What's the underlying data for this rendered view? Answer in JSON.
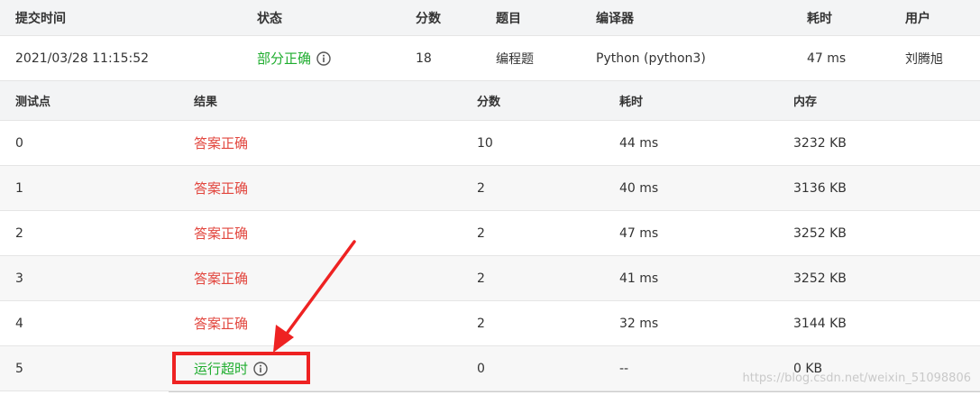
{
  "summary": {
    "headers": {
      "submit_time": "提交时间",
      "status": "状态",
      "score": "分数",
      "problem": "题目",
      "compiler": "编译器",
      "time_cost": "耗时",
      "user": "用户"
    },
    "row": {
      "submit_time": "2021/03/28 11:15:52",
      "status": "部分正确",
      "score": "18",
      "problem": "编程题",
      "compiler": "Python (python3)",
      "time_cost": "47 ms",
      "user": "刘腾旭"
    }
  },
  "details": {
    "headers": {
      "case": "测试点",
      "result": "结果",
      "score": "分数",
      "time_cost": "耗时",
      "memory": "内存"
    },
    "rows": [
      {
        "case": "0",
        "result": "答案正确",
        "score": "10",
        "time_cost": "44 ms",
        "memory": "3232 KB"
      },
      {
        "case": "1",
        "result": "答案正确",
        "score": "2",
        "time_cost": "40 ms",
        "memory": "3136 KB"
      },
      {
        "case": "2",
        "result": "答案正确",
        "score": "2",
        "time_cost": "47 ms",
        "memory": "3252 KB"
      },
      {
        "case": "3",
        "result": "答案正确",
        "score": "2",
        "time_cost": "41 ms",
        "memory": "3252 KB"
      },
      {
        "case": "4",
        "result": "答案正确",
        "score": "2",
        "time_cost": "32 ms",
        "memory": "3144 KB"
      },
      {
        "case": "5",
        "result": "运行超时",
        "score": "0",
        "time_cost": "--",
        "memory": "0 KB"
      }
    ]
  },
  "colors": {
    "partial_correct": "#1fad2f",
    "accepted": "#e2463e",
    "time_limit": "#1fad2f",
    "annotation": "#ee2222"
  },
  "icons": {
    "status_info": "info-circle-icon"
  },
  "watermark": "https://blog.csdn.net/weixin_51098806"
}
